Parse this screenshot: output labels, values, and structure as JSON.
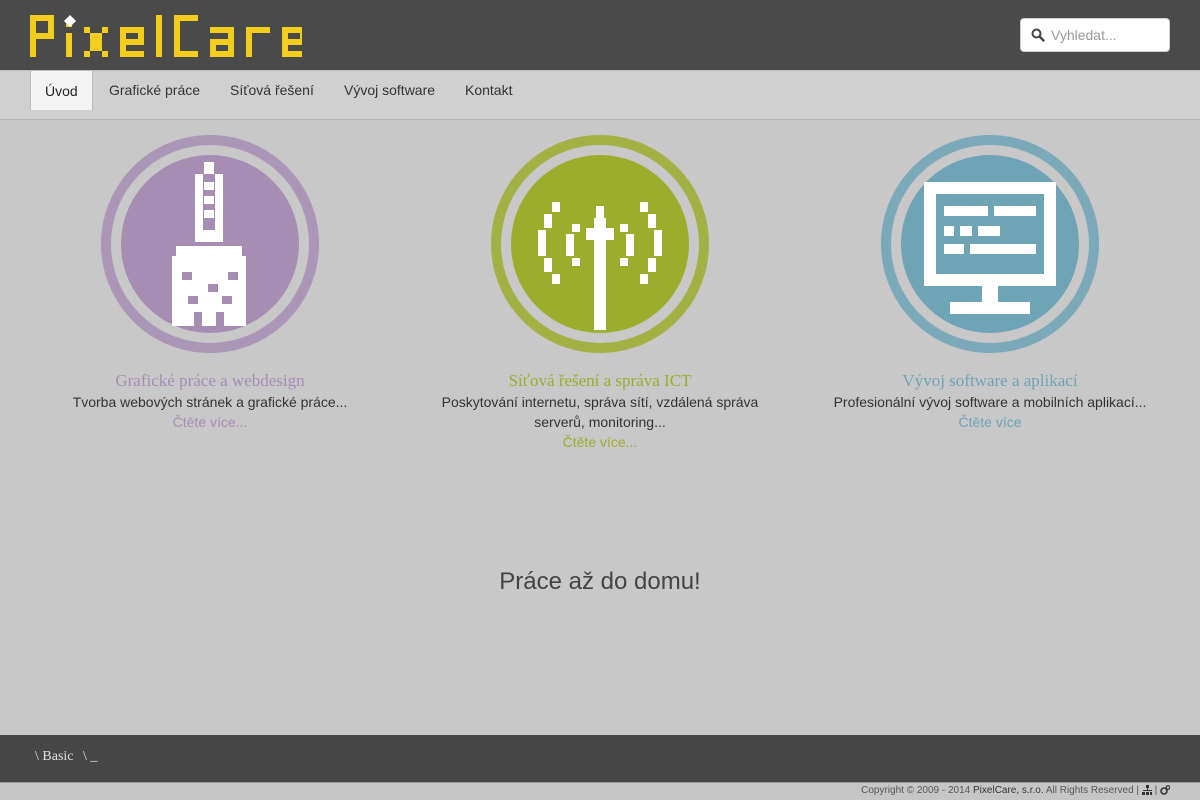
{
  "brand": {
    "name": "PixelCare",
    "logo_color": "#f2cd1c"
  },
  "search": {
    "placeholder": "Vyhledat...",
    "icon": "search-icon"
  },
  "nav": {
    "items": [
      {
        "label": "Úvod",
        "active": true
      },
      {
        "label": "Grafické práce",
        "active": false
      },
      {
        "label": "Síťová řešení",
        "active": false
      },
      {
        "label": "Vývoj software",
        "active": false
      },
      {
        "label": "Kontakt",
        "active": false
      }
    ]
  },
  "features": [
    {
      "icon": "paintbrush-icon",
      "color": "#a58db4",
      "title": "Grafické práce a webdesign",
      "text": "Tvorba webových stránek a grafické práce...",
      "more": "Čtěte více..."
    },
    {
      "icon": "antenna-icon",
      "color": "#9cac2d",
      "title": "Síťová řešení a správa ICT",
      "text": "Poskytování internetu, správa sítí, vzdálená správa serverů, monitoring...",
      "more": "Čtěte více..."
    },
    {
      "icon": "monitor-icon",
      "color": "#6fa3b6",
      "title": "Vývoj software a aplikací",
      "text": "Profesionální vývoj software a mobilních aplikací...",
      "more": "Čtěte více"
    }
  ],
  "tagline": "Práce až do domu!",
  "footer": {
    "crumbs": [
      "\\ Basic",
      "\\ _"
    ],
    "copyright_prefix": "Copyright © 2009 - 2014",
    "company": "PixelCare, s.r.o.",
    "rights": "All Rights Reserved |",
    "separator": "|",
    "icons": [
      "sitemap-icon",
      "gears-icon"
    ]
  }
}
